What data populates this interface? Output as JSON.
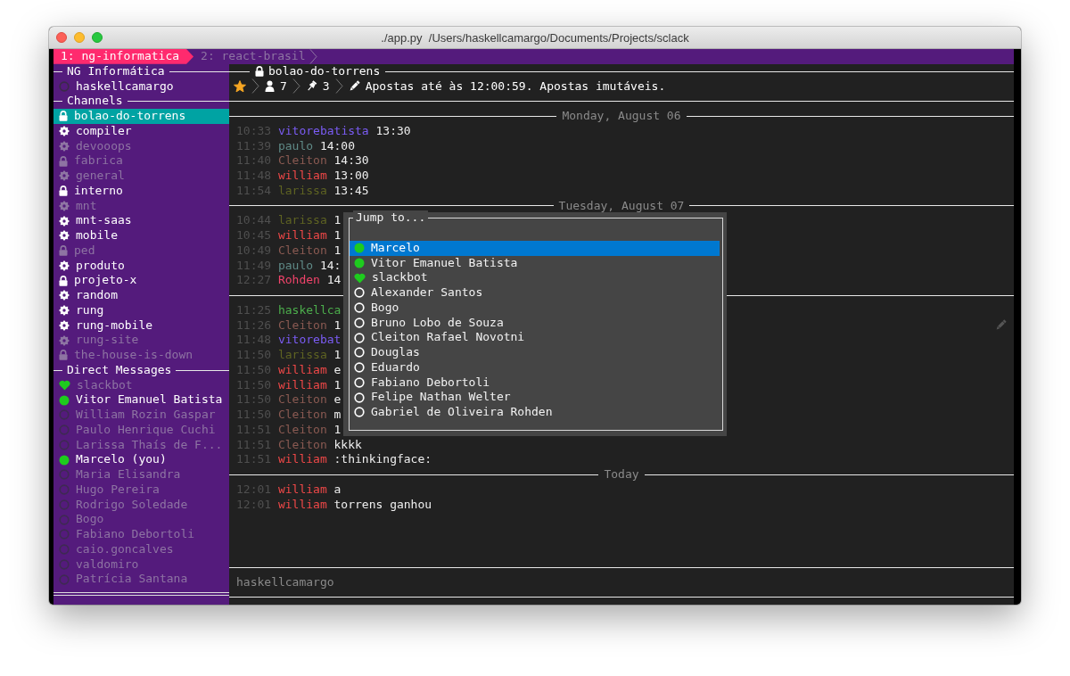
{
  "window": {
    "title": "./app.py  /Users/haskellcamargo/Documents/Projects/sclack"
  },
  "tabs": [
    {
      "label": "1: ng-informatica",
      "selected": true
    },
    {
      "label": "2: react-brasil",
      "selected": false
    }
  ],
  "sidebar": {
    "team": "NG Informática",
    "user": {
      "name": "haskellcamargo",
      "kind": "offline"
    },
    "channels_heading": "Channels",
    "channels": [
      {
        "name": "bolao-do-torrens",
        "kind": "private",
        "selected": true,
        "unread": true
      },
      {
        "name": "compiler",
        "kind": "public",
        "selected": false,
        "unread": true
      },
      {
        "name": "devooops",
        "kind": "public",
        "selected": false,
        "unread": false
      },
      {
        "name": "fabrica",
        "kind": "private",
        "selected": false,
        "unread": false
      },
      {
        "name": "general",
        "kind": "public",
        "selected": false,
        "unread": false
      },
      {
        "name": "interno",
        "kind": "private",
        "selected": false,
        "unread": true
      },
      {
        "name": "mnt",
        "kind": "public",
        "selected": false,
        "unread": false
      },
      {
        "name": "mnt-saas",
        "kind": "public",
        "selected": false,
        "unread": true
      },
      {
        "name": "mobile",
        "kind": "public",
        "selected": false,
        "unread": true
      },
      {
        "name": "ped",
        "kind": "private",
        "selected": false,
        "unread": false
      },
      {
        "name": "produto",
        "kind": "public",
        "selected": false,
        "unread": true
      },
      {
        "name": "projeto-x",
        "kind": "private",
        "selected": false,
        "unread": true
      },
      {
        "name": "random",
        "kind": "public",
        "selected": false,
        "unread": true
      },
      {
        "name": "rung",
        "kind": "public",
        "selected": false,
        "unread": true
      },
      {
        "name": "rung-mobile",
        "kind": "public",
        "selected": false,
        "unread": true
      },
      {
        "name": "rung-site",
        "kind": "public",
        "selected": false,
        "unread": false
      },
      {
        "name": "the-house-is-down",
        "kind": "private",
        "selected": false,
        "unread": false
      }
    ],
    "dm_heading": "Direct Messages",
    "direct_messages": [
      {
        "name": "slackbot",
        "kind": "bot",
        "selected": false
      },
      {
        "name": "Vitor Emanuel Batista",
        "kind": "online",
        "selected": false
      },
      {
        "name": "William Rozin Gaspar",
        "kind": "offline",
        "selected": false
      },
      {
        "name": "Paulo Henrique Cuchi",
        "kind": "offline",
        "selected": false
      },
      {
        "name": "Larissa Thaís de F...",
        "kind": "offline",
        "selected": false
      },
      {
        "name": "Marcelo (you)",
        "kind": "online",
        "selected": false
      },
      {
        "name": "Maria Elisandra",
        "kind": "offline",
        "selected": false
      },
      {
        "name": "Hugo Pereira",
        "kind": "offline",
        "selected": false
      },
      {
        "name": "Rodrigo Soledade",
        "kind": "offline",
        "selected": false
      },
      {
        "name": "Bogo",
        "kind": "offline",
        "selected": false
      },
      {
        "name": "Fabiano Debortoli",
        "kind": "offline",
        "selected": false
      },
      {
        "name": "caio.goncalves",
        "kind": "offline",
        "selected": false
      },
      {
        "name": "valdomiro",
        "kind": "offline",
        "selected": false
      },
      {
        "name": "Patrícia Santana",
        "kind": "offline",
        "selected": false
      }
    ]
  },
  "channel": {
    "name": "bolao-do-torrens",
    "kind": "private",
    "starred": true,
    "members": "7",
    "pins": "3",
    "topic": "Apostas até às 12:00:59. Apostas imutáveis."
  },
  "message_groups": [
    {
      "date": "Monday, August 06",
      "messages": [
        {
          "time": "10:33",
          "author": "vitorebatista",
          "color": "#7b5cf5",
          "text": "13:30",
          "edited": false
        },
        {
          "time": "11:39",
          "author": "paulo",
          "color": "#5f8a87",
          "text": "14:00",
          "edited": false
        },
        {
          "time": "11:40",
          "author": "Cleiton",
          "color": "#8a5a52",
          "text": "14:30",
          "edited": false
        },
        {
          "time": "11:48",
          "author": "william",
          "color": "#f04848",
          "text": "13:00",
          "edited": false
        },
        {
          "time": "11:54",
          "author": "larissa",
          "color": "#5e6322",
          "text": "13:45",
          "edited": false
        }
      ]
    },
    {
      "date": "Tuesday, August 07",
      "messages": [
        {
          "time": "10:44",
          "author": "larissa",
          "color": "#5e6322",
          "text": "1",
          "edited": false
        },
        {
          "time": "10:45",
          "author": "william",
          "color": "#f04848",
          "text": "1",
          "edited": false
        },
        {
          "time": "10:49",
          "author": "Cleiton",
          "color": "#8a5a52",
          "text": "1",
          "edited": false
        },
        {
          "time": "11:49",
          "author": "paulo",
          "color": "#5f8a87",
          "text": "14:",
          "edited": false
        },
        {
          "time": "12:27",
          "author": "Rohden",
          "color": "#f0436a",
          "text": "14",
          "edited": false
        }
      ]
    },
    {
      "messages": [
        {
          "time": "11:25",
          "author": "haskellca",
          "color": "#4cae4c",
          "edited": false
        },
        {
          "time": "11:26",
          "author": "Cleiton",
          "color": "#8a5a52",
          "text": "1",
          "edited": true
        },
        {
          "time": "11:48",
          "author": "vitorebat",
          "color": "#7b5cf5",
          "edited": false
        },
        {
          "time": "11:50",
          "author": "larissa",
          "color": "#5e6322",
          "text": "1",
          "edited": false
        },
        {
          "time": "11:50",
          "author": "william",
          "color": "#f04848",
          "text": "e",
          "edited": false
        },
        {
          "time": "11:50",
          "author": "william",
          "color": "#f04848",
          "text": "1",
          "edited": false
        },
        {
          "time": "11:50",
          "author": "Cleiton",
          "color": "#8a5a52",
          "text": "e",
          "edited": false
        },
        {
          "time": "11:50",
          "author": "Cleiton",
          "color": "#8a5a52",
          "text": "m",
          "edited": false
        },
        {
          "time": "11:51",
          "author": "Cleiton",
          "color": "#8a5a52",
          "text": "1",
          "edited": false
        },
        {
          "time": "11:51",
          "author": "Cleiton",
          "color": "#8a5a52",
          "text": "kkkk",
          "edited": false
        },
        {
          "time": "11:51",
          "author": "william",
          "color": "#f04848",
          "text": ":thinkingface:",
          "edited": false
        }
      ]
    },
    {
      "date": "Today",
      "messages": [
        {
          "time": "12:01",
          "author": "william",
          "color": "#f04848",
          "text": "a",
          "edited": false
        },
        {
          "time": "12:01",
          "author": "william",
          "color": "#f04848",
          "text": "torrens ganhou",
          "edited": false
        }
      ]
    }
  ],
  "message_input": {
    "placeholder": "haskellcamargo"
  },
  "jump_to": {
    "title": "Jump to...",
    "items": [
      {
        "name": "Marcelo",
        "kind": "online",
        "selected": true
      },
      {
        "name": "Vitor Emanuel Batista",
        "kind": "online",
        "selected": false
      },
      {
        "name": "slackbot",
        "kind": "bot",
        "selected": false
      },
      {
        "name": "Alexander Santos",
        "kind": "offline",
        "selected": false
      },
      {
        "name": "Bogo",
        "kind": "offline",
        "selected": false
      },
      {
        "name": "Bruno Lobo de Souza",
        "kind": "offline",
        "selected": false
      },
      {
        "name": "Cleiton Rafael Novotni",
        "kind": "offline",
        "selected": false
      },
      {
        "name": "Douglas",
        "kind": "offline",
        "selected": false
      },
      {
        "name": "Eduardo",
        "kind": "offline",
        "selected": false
      },
      {
        "name": "Fabiano Debortoli",
        "kind": "offline",
        "selected": false
      },
      {
        "name": "Felipe Nathan Welter",
        "kind": "offline",
        "selected": false
      },
      {
        "name": "Gabriel de Oliveira Rohden",
        "kind": "offline",
        "selected": false
      }
    ]
  }
}
